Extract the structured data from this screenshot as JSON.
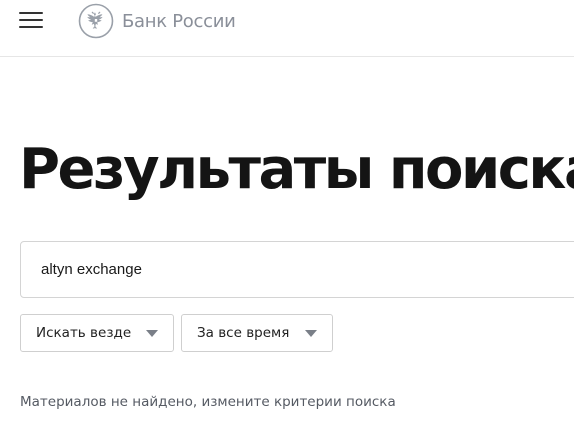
{
  "header": {
    "menu_icon": "hamburger-menu-icon",
    "logo_icon": "double-headed-eagle-emblem",
    "logo_text": "Банк России"
  },
  "main": {
    "title": "Результаты поиска",
    "search": {
      "value": "altyn exchange",
      "placeholder": ""
    },
    "filters": {
      "scope_selected": "Искать везде",
      "period_selected": "За все время"
    },
    "message": "Материалов не найдено, измените критерии поиска"
  },
  "colors": {
    "logo_text": "#8a8f99",
    "title": "#141414",
    "border": "#d4d4d4",
    "message": "#555a63"
  }
}
